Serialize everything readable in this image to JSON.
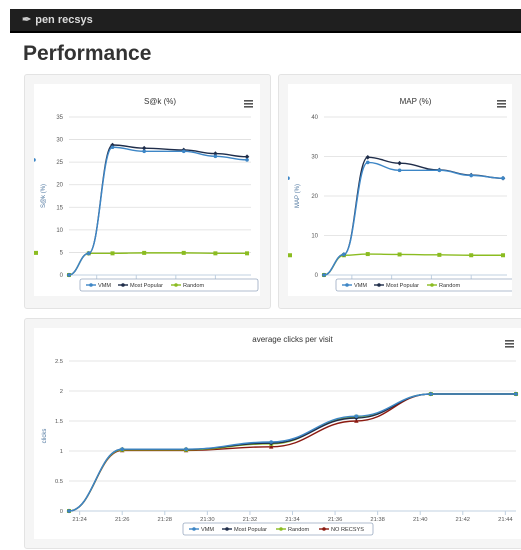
{
  "navbar": {
    "brand": "pen recsys"
  },
  "page": {
    "title": "Performance"
  },
  "colors": {
    "VMM": "#3d86c6",
    "Most Popular": "#1f2d4a",
    "Random": "#8bbc21",
    "NO RECSYS": "#8b1a10"
  },
  "chart_data": [
    {
      "type": "line",
      "title": "S@k (%)",
      "xlabel": "",
      "ylabel": "S@k (%)",
      "ylim": [
        0,
        35
      ],
      "yticks": [
        "0",
        "5",
        "10",
        "15",
        "20",
        "25",
        "30",
        "35"
      ],
      "xlim": [
        "21:21:30",
        "21:44:30"
      ],
      "xticks": [
        "21:25",
        "21:30",
        "21:35",
        "21:40"
      ],
      "grid": true,
      "legend": "bottom-center",
      "x": [
        "21:21:30",
        "21:24",
        "21:27",
        "21:31",
        "21:36",
        "21:40",
        "21:44"
      ],
      "series": [
        {
          "name": "VMM",
          "values": [
            0,
            4.8,
            28.3,
            27.4,
            27.4,
            26.3,
            25.5,
            25.5
          ]
        },
        {
          "name": "Most Popular",
          "values": [
            0,
            4.8,
            28.8,
            28.1,
            27.7,
            26.9,
            26.2,
            26.2
          ]
        },
        {
          "name": "Random",
          "values": [
            0,
            4.8,
            4.8,
            4.9,
            4.9,
            4.8,
            4.8,
            4.9
          ]
        }
      ]
    },
    {
      "type": "line",
      "title": "MAP (%)",
      "xlabel": "",
      "ylabel": "MAP (%)",
      "ylim": [
        0,
        40
      ],
      "yticks": [
        "0",
        "10",
        "20",
        "30",
        "40"
      ],
      "xlim": [
        "21:21:30",
        "21:44:30"
      ],
      "xticks": [
        "21:25",
        "21:30",
        "21:35",
        "21:40"
      ],
      "grid": true,
      "legend": "bottom-center",
      "series": [
        {
          "name": "VMM",
          "values": [
            0,
            5.2,
            28.5,
            26.5,
            26.5,
            25.2,
            24.5,
            24.5
          ]
        },
        {
          "name": "Most Popular",
          "values": [
            0,
            5.2,
            29.8,
            28.3,
            26.6,
            25.3,
            24.5,
            24.5
          ]
        },
        {
          "name": "Random",
          "values": [
            0,
            5.0,
            5.3,
            5.2,
            5.1,
            5.0,
            5.0,
            5.0
          ]
        }
      ]
    },
    {
      "type": "line",
      "title": "average clicks per visit",
      "xlabel": "",
      "ylabel": "clicks",
      "ylim": [
        0,
        2.5
      ],
      "yticks": [
        "0",
        "0.5",
        "1",
        "1.5",
        "2",
        "2.5"
      ],
      "xlim": [
        "21:23:30",
        "21:44:30"
      ],
      "xticks": [
        "21:24",
        "21:26",
        "21:28",
        "21:30",
        "21:32",
        "21:34",
        "21:36",
        "21:38",
        "21:40",
        "21:42",
        "21:44"
      ],
      "grid": true,
      "legend": "bottom-center",
      "x": [
        "21:23:30",
        "21:26",
        "21:29",
        "21:33",
        "21:37",
        "21:40:30",
        "21:44:30"
      ],
      "series": [
        {
          "name": "VMM",
          "values": [
            0,
            1.03,
            1.03,
            1.15,
            1.58,
            1.95,
            1.95
          ]
        },
        {
          "name": "Most Popular",
          "values": [
            0,
            1.03,
            1.03,
            1.13,
            1.55,
            1.95,
            1.95
          ]
        },
        {
          "name": "Random",
          "values": [
            0,
            1.02,
            1.02,
            1.12,
            1.57,
            1.95,
            1.95
          ]
        },
        {
          "name": "NO RECSYS",
          "values": [
            0,
            1.01,
            1.01,
            1.07,
            1.5,
            1.95,
            1.95
          ]
        }
      ]
    }
  ]
}
